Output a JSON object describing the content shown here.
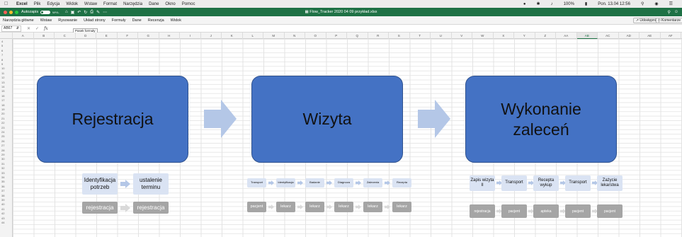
{
  "menubar": {
    "app": "Excel",
    "items": [
      "Plik",
      "Edycja",
      "Widok",
      "Wstaw",
      "Format",
      "Narzędzia",
      "Dane",
      "Okno",
      "Pomoc"
    ],
    "battery": "100%",
    "clock": "Pon. 13.04  12:56"
  },
  "titlebar": {
    "autosave": "Autozapis",
    "autosave_state": "WYŁ.",
    "document": "Flow_Tracker 2020 04 09 przykład.xlsx"
  },
  "ribbon": {
    "tabs": [
      "Narzędzia główne",
      "Wstaw",
      "Rysowanie",
      "Układ strony",
      "Formuły",
      "Dane",
      "Recenzja",
      "Widok"
    ],
    "share": "Udostępnij",
    "comments": "Komentarze"
  },
  "formula_bar": {
    "cell": "AB67",
    "fx": "fx",
    "tooltip": "Pasek formuły",
    "value": ""
  },
  "columns": [
    "A",
    "B",
    "C",
    "D",
    "E",
    "F",
    "G",
    "H",
    "I",
    "J",
    "K",
    "L",
    "M",
    "N",
    "O",
    "P",
    "Q",
    "R",
    "S",
    "T",
    "U",
    "V",
    "W",
    "X",
    "Y",
    "Z",
    "AA",
    "AB",
    "AC",
    "AD",
    "AE",
    "AF"
  ],
  "selected_column": "AB",
  "rows": [
    "4",
    "5",
    "6",
    "7",
    "8",
    "9",
    "10",
    "11",
    "12",
    "13",
    "14",
    "15",
    "16",
    "17",
    "18",
    "19",
    "20",
    "21",
    "22",
    "23",
    "24",
    "25",
    "26",
    "27",
    "28",
    "29",
    "30",
    "31",
    "32",
    "33",
    "34",
    "35",
    "36",
    "37",
    "38",
    "39",
    "40",
    "41",
    "42",
    "43",
    "44"
  ],
  "colors": {
    "process_fill": "#4472c4",
    "arrow_fill": "#b4c7e7",
    "light_step": "#dae3f3",
    "grey_step": "#a5a5a5",
    "excel_green": "#1e7145"
  },
  "flow": {
    "stages": [
      "Rejestracja",
      "Wizyta",
      "Wykonanie zaleceń"
    ],
    "stage1_steps": [
      "Identyfikacja potrzeb",
      "ustalenie terminu"
    ],
    "stage1_roles": [
      "rejestracja",
      "rejestracja"
    ],
    "stage2_steps": [
      "Transport",
      "Identyfikacja",
      "Badanie",
      "Diagnoza",
      "Zalecenia",
      "Recepta"
    ],
    "stage2_roles": [
      "pacjent",
      "lekarz",
      "lekarz",
      "lekarz",
      "lekarz",
      "lekarz"
    ],
    "stage3_steps": [
      "Zapis wizyta II",
      "Transport",
      "Recepta wykup",
      "Transport",
      "Zażycie lekarstwa"
    ],
    "stage3_roles": [
      "rejestracja",
      "pacjent",
      "apteka",
      "pacjent",
      "pacjent"
    ]
  }
}
